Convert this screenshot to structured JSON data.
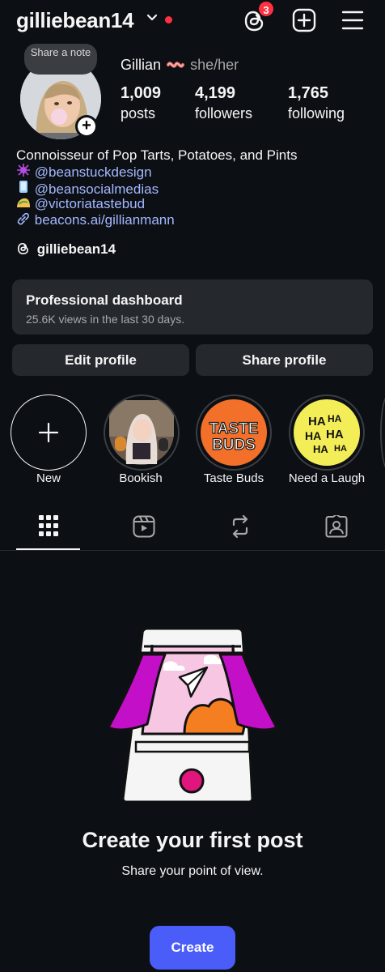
{
  "header": {
    "username": "gilliebean14",
    "threads_badge": "3"
  },
  "profile": {
    "note_label": "Share a note",
    "display_name": "Gillian",
    "pronouns": "she/her",
    "stats": [
      {
        "value": "1,009",
        "label": "posts"
      },
      {
        "value": "4,199",
        "label": "followers"
      },
      {
        "value": "1,765",
        "label": "following"
      }
    ]
  },
  "bio": {
    "line1": "Connoisseur of Pop Tarts, Potatoes, and Pints",
    "line2": "@beanstuckdesign",
    "line3": "@beansocialmedias",
    "line4": "@victoriatastebud",
    "link": "beacons.ai/gillianmann"
  },
  "threads_handle": "gilliebean14",
  "dashboard": {
    "title": "Professional dashboard",
    "subtitle": "25.6K views in the last 30 days."
  },
  "buttons": {
    "edit": "Edit profile",
    "share": "Share profile"
  },
  "highlights": [
    {
      "label": "New"
    },
    {
      "label": "Bookish"
    },
    {
      "label": "Taste Buds"
    },
    {
      "label": "Need a Laugh"
    }
  ],
  "highlight_art": {
    "taste_line1": "TASTE",
    "taste_line2": "BUDS",
    "haha": "HA"
  },
  "empty_state": {
    "title": "Create your first post",
    "subtitle": "Share your point of view.",
    "button": "Create"
  },
  "colors": {
    "background": "#0c0f14",
    "surface": "#25292e",
    "accent": "#4a5df9",
    "link": "#a4b8ff",
    "notification": "#ff3040"
  }
}
